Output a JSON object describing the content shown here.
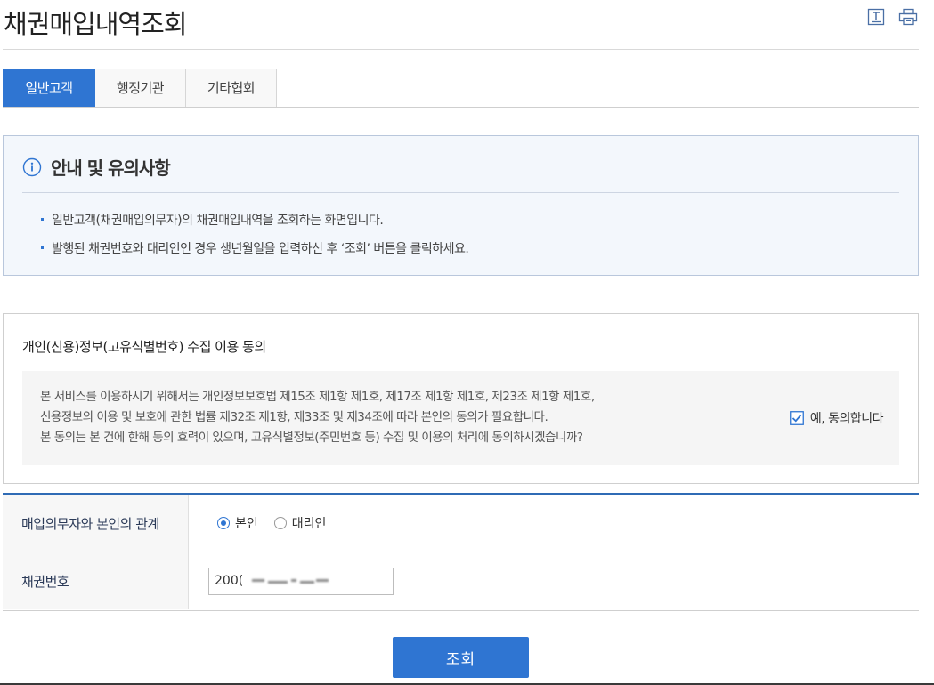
{
  "page": {
    "title": "채권매입내역조회",
    "icons": [
      "text-size-icon",
      "print-icon"
    ]
  },
  "tabs": [
    {
      "label": "일반고객",
      "active": true
    },
    {
      "label": "행정기관",
      "active": false
    },
    {
      "label": "기타협회",
      "active": false
    }
  ],
  "notice": {
    "title": "안내 및 유의사항",
    "items": [
      "일반고객(채권매입의무자)의 채권매입내역을 조회하는 화면입니다.",
      "발행된 채권번호와 대리인인 경우 생년월일을 입력하신 후 ‘조회’ 버튼을 클릭하세요."
    ]
  },
  "consent": {
    "title": "개인(신용)정보(고유식별번호) 수집 이용 동의",
    "lines": [
      "본 서비스를 이용하시기 위해서는 개인정보보호법 제15조 제1항 제1호, 제17조 제1항 제1호, 제23조 제1항 제1호,",
      "신용정보의 이용 및 보호에 관한 법률 제32조 제1항, 제33조 및 제34조에 따라 본인의 동의가 필요합니다.",
      "본 동의는 본 건에 한해 동의 효력이 있으며, 고유식별정보(주민번호 등) 수집 및 이용의 처리에 동의하시겠습니까?"
    ],
    "agree_label": "예, 동의합니다",
    "agreed": true
  },
  "form": {
    "relation_label": "매입의무자와 본인의 관계",
    "relation_options": [
      {
        "label": "본인",
        "selected": true
      },
      {
        "label": "대리인",
        "selected": false
      }
    ],
    "bond_label": "채권번호",
    "bond_value": "200("
  },
  "search_button": "조회",
  "colors": {
    "accent": "#2f75d2",
    "notice_bg": "#f3f7fc",
    "form_border": "#2f6bb5"
  }
}
